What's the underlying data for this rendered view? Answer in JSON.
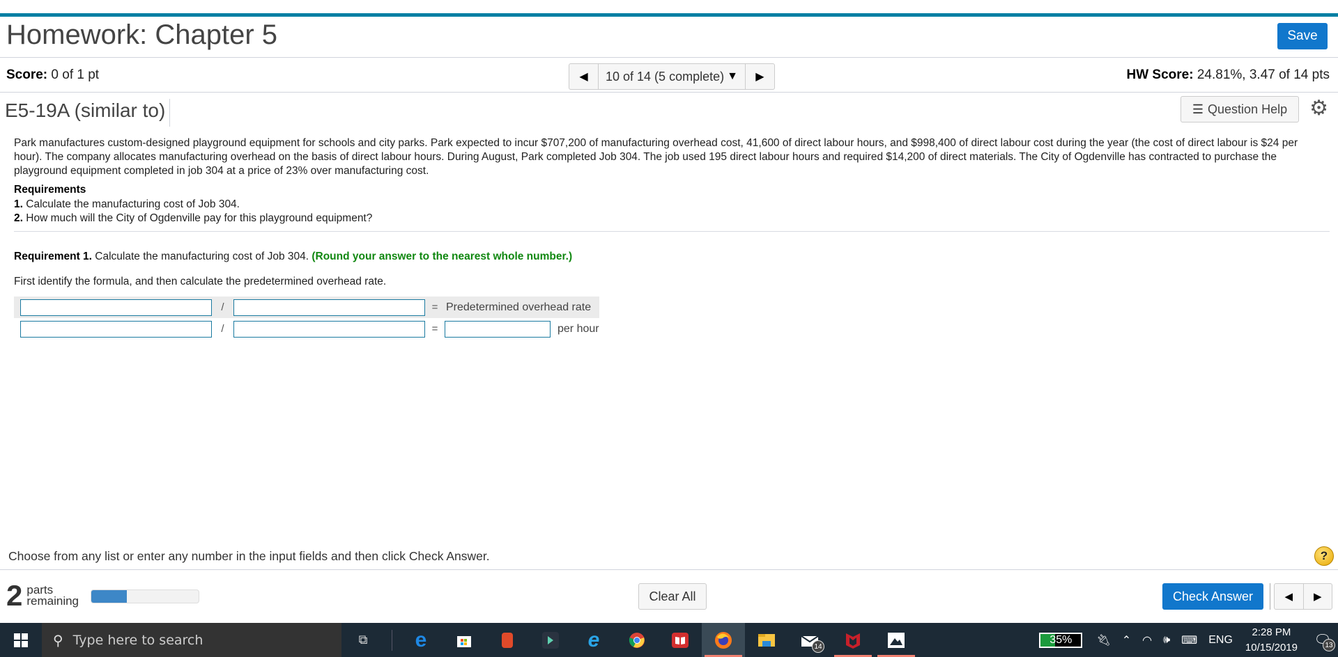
{
  "header": {
    "title": "Homework: Chapter 5",
    "save_label": "Save"
  },
  "score_bar": {
    "score_label": "Score:",
    "score_value": "0 of 1 pt",
    "nav_text": "10 of 14 (5 complete)",
    "hw_score_label": "HW Score:",
    "hw_score_value": "24.81%, 3.47 of 14 pts"
  },
  "question": {
    "id": "E5-19A (similar to)",
    "help_label": "Question Help",
    "problem_text": "Park manufactures custom-designed playground equipment for schools and city parks. Park expected to incur $707,200 of manufacturing overhead cost, 41,600 of direct labour hours, and $998,400 of direct labour cost during the year (the cost of direct labour is $24 per hour). The company allocates manufacturing overhead on the basis of direct labour hours. During August, Park completed Job 304. The job used 195 direct labour hours and required $14,200 of direct materials. The City of Ogdenville has contracted to purchase the playground equipment completed in job 304 at a price of 23% over manufacturing cost.",
    "requirements_heading": "Requirements",
    "requirements": [
      {
        "num": "1.",
        "text": "Calculate the manufacturing cost of Job 304."
      },
      {
        "num": "2.",
        "text": "How much will the City of Ogdenville pay for this playground equipment?"
      }
    ],
    "req1_label": "Requirement 1.",
    "req1_text": "Calculate the manufacturing cost of Job 304.",
    "req1_hint": "(Round your answer to the nearest whole number.)",
    "instruction": "First identify the formula, and then calculate the predetermined overhead rate.",
    "formula": {
      "row1": {
        "input1": "",
        "op": "/",
        "input2": "",
        "eq": "=",
        "label": "Predetermined overhead rate"
      },
      "row2": {
        "input1": "",
        "op": "/",
        "input2": "",
        "eq": "=",
        "result": "",
        "unit": "per hour"
      }
    }
  },
  "footer": {
    "instruction": "Choose from any list or enter any number in the input fields and then click Check Answer.",
    "help_symbol": "?",
    "parts_count": "2",
    "parts_label_1": "parts",
    "parts_label_2": "remaining",
    "progress_percent": 33,
    "clear_label": "Clear All",
    "check_label": "Check Answer"
  },
  "taskbar": {
    "search_placeholder": "Type here to search",
    "mail_badge": "14",
    "battery": "35%",
    "battery_level": 35,
    "language": "ENG",
    "time": "2:28 PM",
    "date": "10/15/2019",
    "notifications": "13"
  }
}
